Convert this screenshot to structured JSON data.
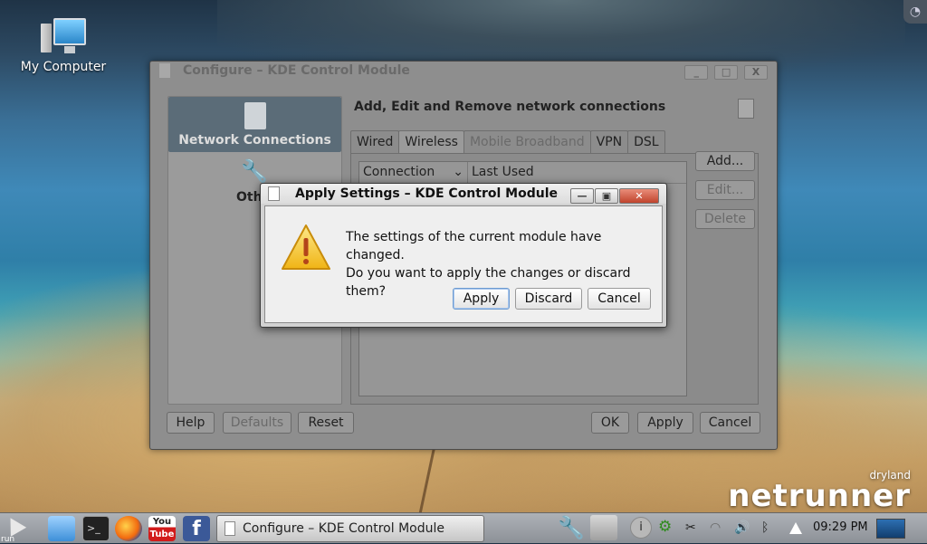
{
  "desktop": {
    "icon_label": "My Computer",
    "brand_small": "dryland",
    "brand_big": "netrunner"
  },
  "main_window": {
    "title": "Configure – KDE Control Module",
    "window_buttons": [
      "_",
      "□",
      "X"
    ],
    "left_items": [
      "Network Connections",
      "Oth"
    ],
    "heading": "Add, Edit and Remove network connections",
    "tabs": [
      "Wired",
      "Wireless",
      "Mobile Broadband",
      "VPN",
      "DSL"
    ],
    "list_columns": [
      "Connection",
      "Last Used"
    ],
    "side_buttons": [
      "Add...",
      "Edit...",
      "Delete"
    ],
    "bottom_buttons": {
      "help": "Help",
      "defaults": "Defaults",
      "reset": "Reset",
      "ok": "OK",
      "apply": "Apply",
      "cancel": "Cancel"
    }
  },
  "dialog": {
    "title": "Apply Settings – KDE Control Module",
    "message_line1": "The settings of the current module have changed.",
    "message_line2": "Do you want to apply the changes or discard them?",
    "buttons": {
      "apply": "Apply",
      "discard": "Discard",
      "cancel": "Cancel"
    }
  },
  "taskbar": {
    "launcher_label": "run",
    "task_label": "Configure – KDE Control Module",
    "clock": "09:29 PM"
  },
  "colors": {
    "dialog_default_button_border": "#6e9bd0",
    "close_button": "#c0442d",
    "warning_yellow": "#f3c623"
  }
}
